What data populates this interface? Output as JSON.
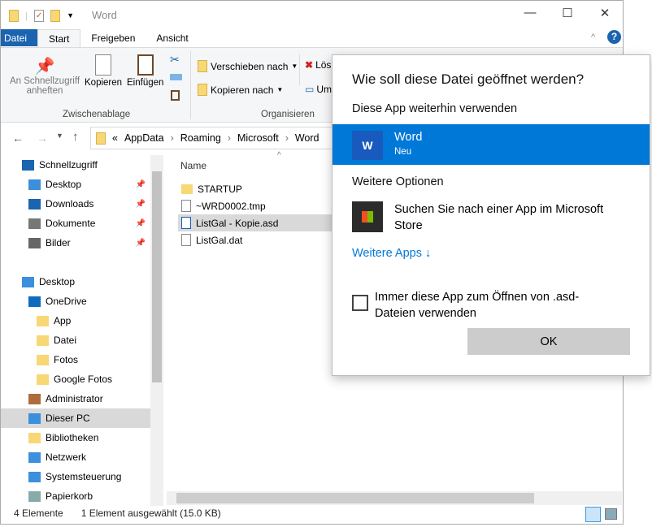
{
  "window": {
    "title": "Word",
    "minimize": "—",
    "maximize": "☐",
    "close": "✕",
    "help": "?",
    "collapse": "^"
  },
  "tabs": [
    "Datei",
    "Start",
    "Freigeben",
    "Ansicht"
  ],
  "ribbon": {
    "pin": "An Schnellzugriff anheften",
    "copy": "Kopieren",
    "paste": "Einfügen",
    "clipboard_group": "Zwischenablage",
    "move_to": "Verschieben nach",
    "copy_to": "Kopieren nach",
    "delete": "Lös",
    "rename": "Um",
    "organize_group": "Organisieren"
  },
  "address": {
    "prefix": "«",
    "parts": [
      "AppData",
      "Roaming",
      "Microsoft",
      "Word"
    ]
  },
  "nav": [
    {
      "label": "Schnellzugriff",
      "indent": 0,
      "icon": "star"
    },
    {
      "label": "Desktop",
      "indent": 1,
      "icon": "desktop",
      "pin": true
    },
    {
      "label": "Downloads",
      "indent": 1,
      "icon": "download",
      "pin": true
    },
    {
      "label": "Dokumente",
      "indent": 1,
      "icon": "docs",
      "pin": true
    },
    {
      "label": "Bilder",
      "indent": 1,
      "icon": "pictures",
      "pin": true
    },
    {
      "label": "",
      "indent": 0,
      "icon": ""
    },
    {
      "label": "Desktop",
      "indent": 0,
      "icon": "desktop"
    },
    {
      "label": "OneDrive",
      "indent": 1,
      "icon": "cloud"
    },
    {
      "label": "App",
      "indent": 2,
      "icon": "folder"
    },
    {
      "label": "Datei",
      "indent": 2,
      "icon": "folder"
    },
    {
      "label": "Fotos",
      "indent": 2,
      "icon": "folder"
    },
    {
      "label": "Google Fotos",
      "indent": 2,
      "icon": "folder"
    },
    {
      "label": "Administrator",
      "indent": 1,
      "icon": "user"
    },
    {
      "label": "Dieser PC",
      "indent": 1,
      "icon": "pc",
      "selected": true
    },
    {
      "label": "Bibliotheken",
      "indent": 1,
      "icon": "folder"
    },
    {
      "label": "Netzwerk",
      "indent": 1,
      "icon": "network"
    },
    {
      "label": "Systemsteuerung",
      "indent": 1,
      "icon": "control"
    },
    {
      "label": "Papierkorb",
      "indent": 1,
      "icon": "recycle"
    }
  ],
  "content": {
    "column_name": "Name",
    "files": [
      {
        "name": "STARTUP",
        "icon": "folder"
      },
      {
        "name": "~WRD0002.tmp",
        "icon": "file"
      },
      {
        "name": "ListGal - Kopie.asd",
        "icon": "word",
        "selected": true
      },
      {
        "name": "ListGal.dat",
        "icon": "file"
      }
    ]
  },
  "status": {
    "count": "4 Elemente",
    "selection": "1 Element ausgewählt (15.0 KB)"
  },
  "dialog": {
    "title": "Wie soll diese Datei geöffnet werden?",
    "keep_heading": "Diese App weiterhin verwenden",
    "app_name": "Word",
    "app_sub": "Neu",
    "more_heading": "Weitere Optionen",
    "store_text": "Suchen Sie nach einer App im Microsoft Store",
    "more_apps": "Weitere Apps ↓",
    "always_checkbox": "Immer diese App zum Öffnen von .asd-Dateien verwenden",
    "always_checked": false,
    "ok": "OK",
    "accent": "#0078d7"
  }
}
